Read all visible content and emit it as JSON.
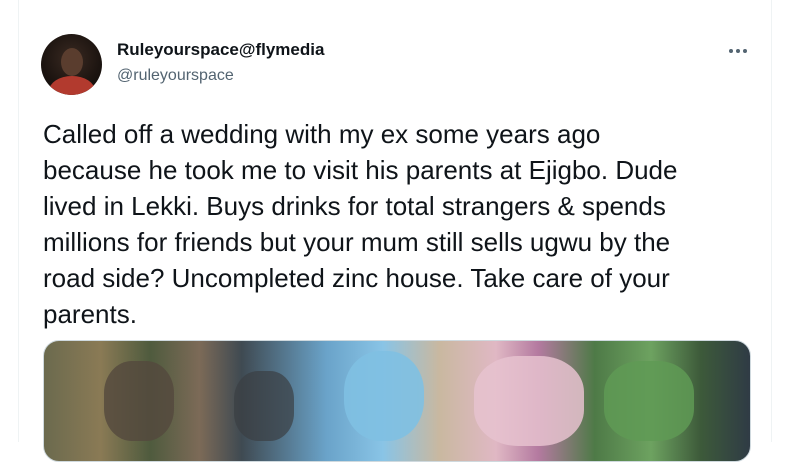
{
  "tweet": {
    "author": {
      "display_name": "Ruleyourspace@flymedia",
      "handle": "@ruleyourspace"
    },
    "more_icon": "more-horizontal-icon",
    "text": "Called off a wedding with my ex some years ago\nbecause he took me to visit his parents at Ejigbo. Dude\nlived in Lekki. Buys drinks for total strangers & spends\nmillions for friends but your mum still sells ugwu by the\nroad side? Uncompleted zinc house. Take care of your\nparents."
  },
  "colors": {
    "text_primary": "#0f1419",
    "text_secondary": "#536471",
    "border": "#eff3f4"
  }
}
